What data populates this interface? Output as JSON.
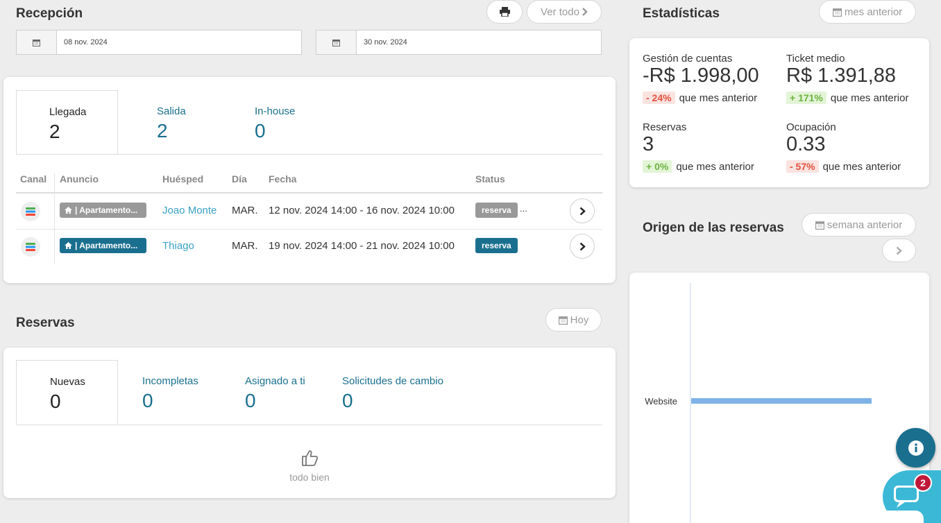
{
  "reception": {
    "title": "Recepción",
    "view_all": "Ver todo",
    "date_from": "08 nov. 2024",
    "date_to": "30 nov. 2024",
    "tabs": [
      {
        "label": "Llegada",
        "count": "2"
      },
      {
        "label": "Salida",
        "count": "2"
      },
      {
        "label": "In-house",
        "count": "0"
      }
    ],
    "columns": [
      "Canal",
      "Anuncio",
      "Huésped",
      "Día",
      "Fecha",
      "Status"
    ],
    "rows": [
      {
        "listing": "| Apartamento...",
        "listing_color": "#999999",
        "guest": "Joao Monte",
        "day": "MAR.",
        "date": "12 nov. 2024 14:00 - 16 nov. 2024 10:00",
        "status": "reserva",
        "status_color": "#999999",
        "extra": "..."
      },
      {
        "listing": "| Apartamento...",
        "listing_color": "#1a6f8f",
        "guest": "Thiago",
        "day": "MAR.",
        "date": "19 nov. 2024 14:00 - 21 nov. 2024 10:00",
        "status": "reserva",
        "status_color": "#1a6f8f",
        "extra": ""
      }
    ]
  },
  "reservations": {
    "title": "Reservas",
    "today": "Hoy",
    "tabs": [
      {
        "label": "Nuevas",
        "count": "0"
      },
      {
        "label": "Incompletas",
        "count": "0"
      },
      {
        "label": "Asignado a ti",
        "count": "0"
      },
      {
        "label": "Solicitudes de cambio",
        "count": "0"
      }
    ],
    "empty_text": "todo bien"
  },
  "stats": {
    "title": "Estadísticas",
    "period": "mes anterior",
    "items": [
      {
        "label": "Gestión de cuentas",
        "value": "-R$ 1.998,00",
        "change": "- 24%",
        "trend": "neg",
        "suffix": "que mes anterior"
      },
      {
        "label": "Ticket medio",
        "value": "R$ 1.391,88",
        "change": "+ 171%",
        "trend": "pos",
        "suffix": "que mes anterior"
      },
      {
        "label": "Reservas",
        "value": "3",
        "change": "+ 0%",
        "trend": "pos",
        "suffix": "que mes anterior"
      },
      {
        "label": "Ocupación",
        "value": "0.33",
        "change": "- 57%",
        "trend": "neg",
        "suffix": "que mes anterior"
      }
    ]
  },
  "origin": {
    "title": "Origen de las reservas",
    "period": "semana anterior",
    "chart_data": {
      "type": "bar",
      "orientation": "horizontal",
      "categories": [
        "Website"
      ],
      "values": [
        1
      ],
      "bar_color": "#7fb3e8",
      "value_axis_visible": false
    }
  },
  "widgets": {
    "chat_badge": "2",
    "accent": "#1a6f8f",
    "chat_color": "#3bb8d6",
    "badge_color": "#c0183a"
  }
}
